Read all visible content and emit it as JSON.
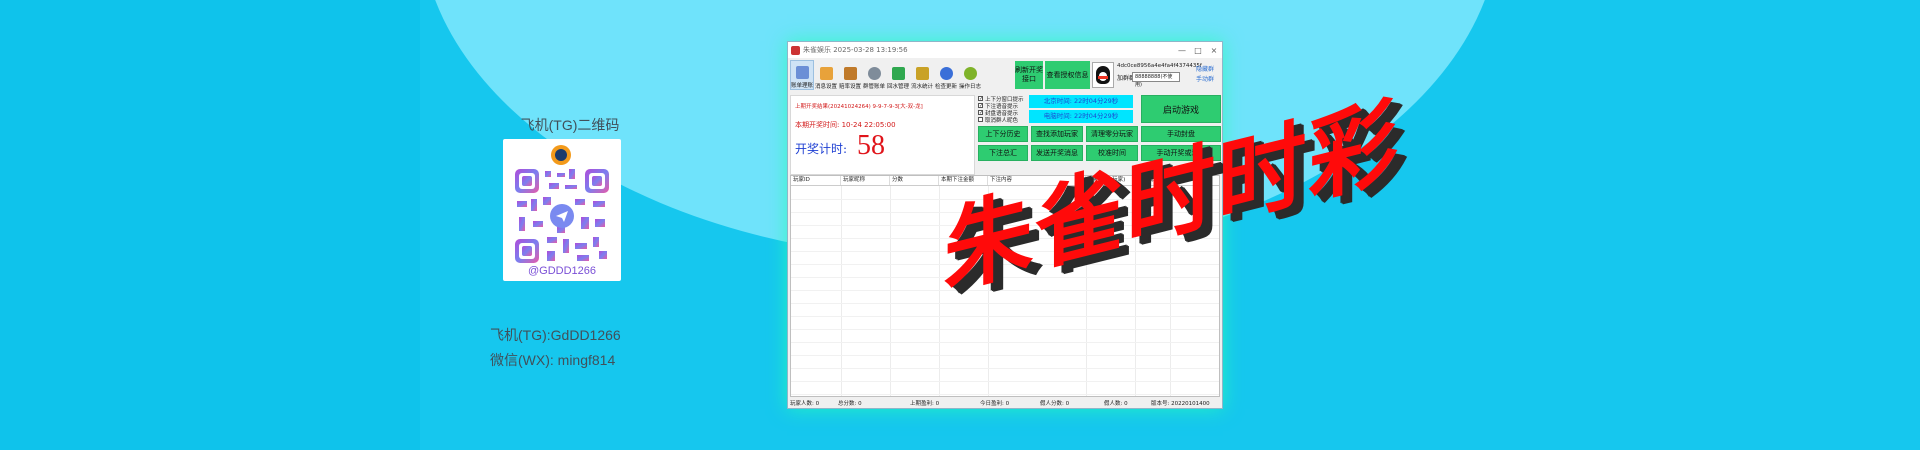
{
  "promo": {
    "qr_title": "飞机(TG)二维码",
    "qr_handle": "@GDDD1266",
    "contact_tg": "飞机(TG):GdDD1266",
    "contact_wx": "微信(WX): mingf814"
  },
  "window": {
    "title": "朱雀娱乐 2025-03-28 13:19:56",
    "controls": [
      "—",
      "□",
      "×"
    ]
  },
  "toolbar": {
    "items": [
      {
        "label": "账单理账",
        "icon": "bill-icon",
        "color": "#6b8fd6"
      },
      {
        "label": "消息设置",
        "icon": "message-icon",
        "color": "#e8a23a"
      },
      {
        "label": "赔率设置",
        "icon": "odds-icon",
        "color": "#c07a2a"
      },
      {
        "label": "群管账单",
        "icon": "group-icon",
        "color": "#7f8c9a"
      },
      {
        "label": "回水管理",
        "icon": "rebate-icon",
        "color": "#2fa84f"
      },
      {
        "label": "流水统计",
        "icon": "stats-icon",
        "color": "#c9a227"
      },
      {
        "label": "检查更新",
        "icon": "update-icon",
        "color": "#3a6fd8"
      },
      {
        "label": "操作日志",
        "icon": "log-icon",
        "color": "#7fb32a"
      }
    ],
    "refresh_button": "刷新开奖接口",
    "auth_button": "查看授权信息"
  },
  "account": {
    "id": "4dc0ce8956a4e4fa4f4374435f",
    "group_label": "加群群",
    "group_select": "88888888(不使用)",
    "link_top": "隐藏群",
    "link_bottom": "手动群"
  },
  "info": {
    "last_result": "上期开奖结果(20241024264)   9-9-7-9-3[大-双-龙]",
    "open_time": "本期开奖时间: 10-24  22:05:00",
    "countdown_label": "开奖计时:",
    "countdown_value": "58"
  },
  "checkboxes": [
    {
      "label": "上下分窗口提示",
      "checked": true
    },
    {
      "label": "下注语音提示",
      "checked": true
    },
    {
      "label": "封盘语音提示",
      "checked": true
    },
    {
      "label": "取消群人昵色",
      "checked": false
    }
  ],
  "clocks": {
    "beijing": "北京时间: 22时04分29秒",
    "computer": "电脑时间: 22时04分29秒"
  },
  "buttons": {
    "start_game": "启动游戏",
    "up_down_history": "上下分历史",
    "find_add_player": "查找添加玩家",
    "clear_zero_players": "清理零分玩家",
    "manual_close": "手动封盘",
    "bet_summary": "下注总汇",
    "send_open_msg": "发送开奖消息",
    "calibrate_time": "校准时间",
    "manual_open_refund": "手动开奖或退款"
  },
  "grid": {
    "columns": [
      "玩家ID",
      "玩家昵称",
      "分数",
      "本期下注金额",
      "下注内容",
      "上期盈亏(玩家)",
      "最后截入"
    ]
  },
  "status": {
    "player_count": "玩家人数: 0",
    "total_score": "总分数: 0",
    "last_profit": "上期盈利: 0",
    "today_profit": "今日盈利: 0",
    "fake_score": "假人分数: 0",
    "fake_count": "假人数: 0",
    "version": "版本号: 20220101400"
  },
  "watermark": "朱雀时时彩",
  "colors": {
    "background": "#16c7ee",
    "light_band": "#6fe3fb",
    "green_button": "#2ecc71",
    "clock_cyan": "#00e5ff",
    "title_red": "#ff0a0a"
  }
}
